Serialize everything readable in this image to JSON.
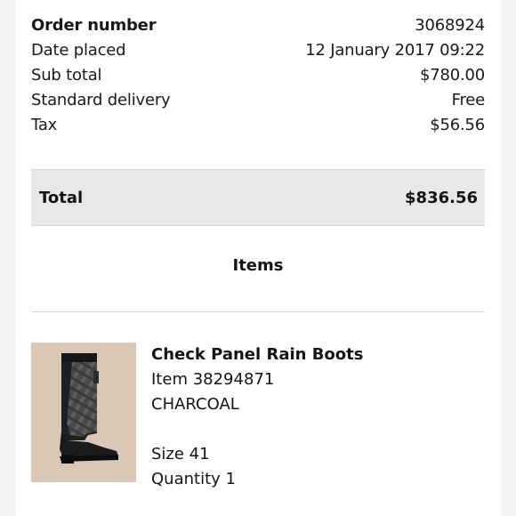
{
  "summary": {
    "order_number_label": "Order number",
    "order_number": "3068924",
    "date_label": "Date placed",
    "date": "12 January 2017 09:22",
    "subtotal_label": "Sub total",
    "subtotal": "$780.00",
    "delivery_label": "Standard delivery",
    "delivery": "Free",
    "tax_label": "Tax",
    "tax": "$56.56"
  },
  "total": {
    "label": "Total",
    "value": "$836.56"
  },
  "items_heading": "Items",
  "item": {
    "name": "Check Panel Rain Boots",
    "item_number": "Item 38294871",
    "color": "CHARCOAL",
    "size": "Size 41",
    "quantity": "Quantity 1",
    "image_icon": "rain-boot-icon"
  }
}
